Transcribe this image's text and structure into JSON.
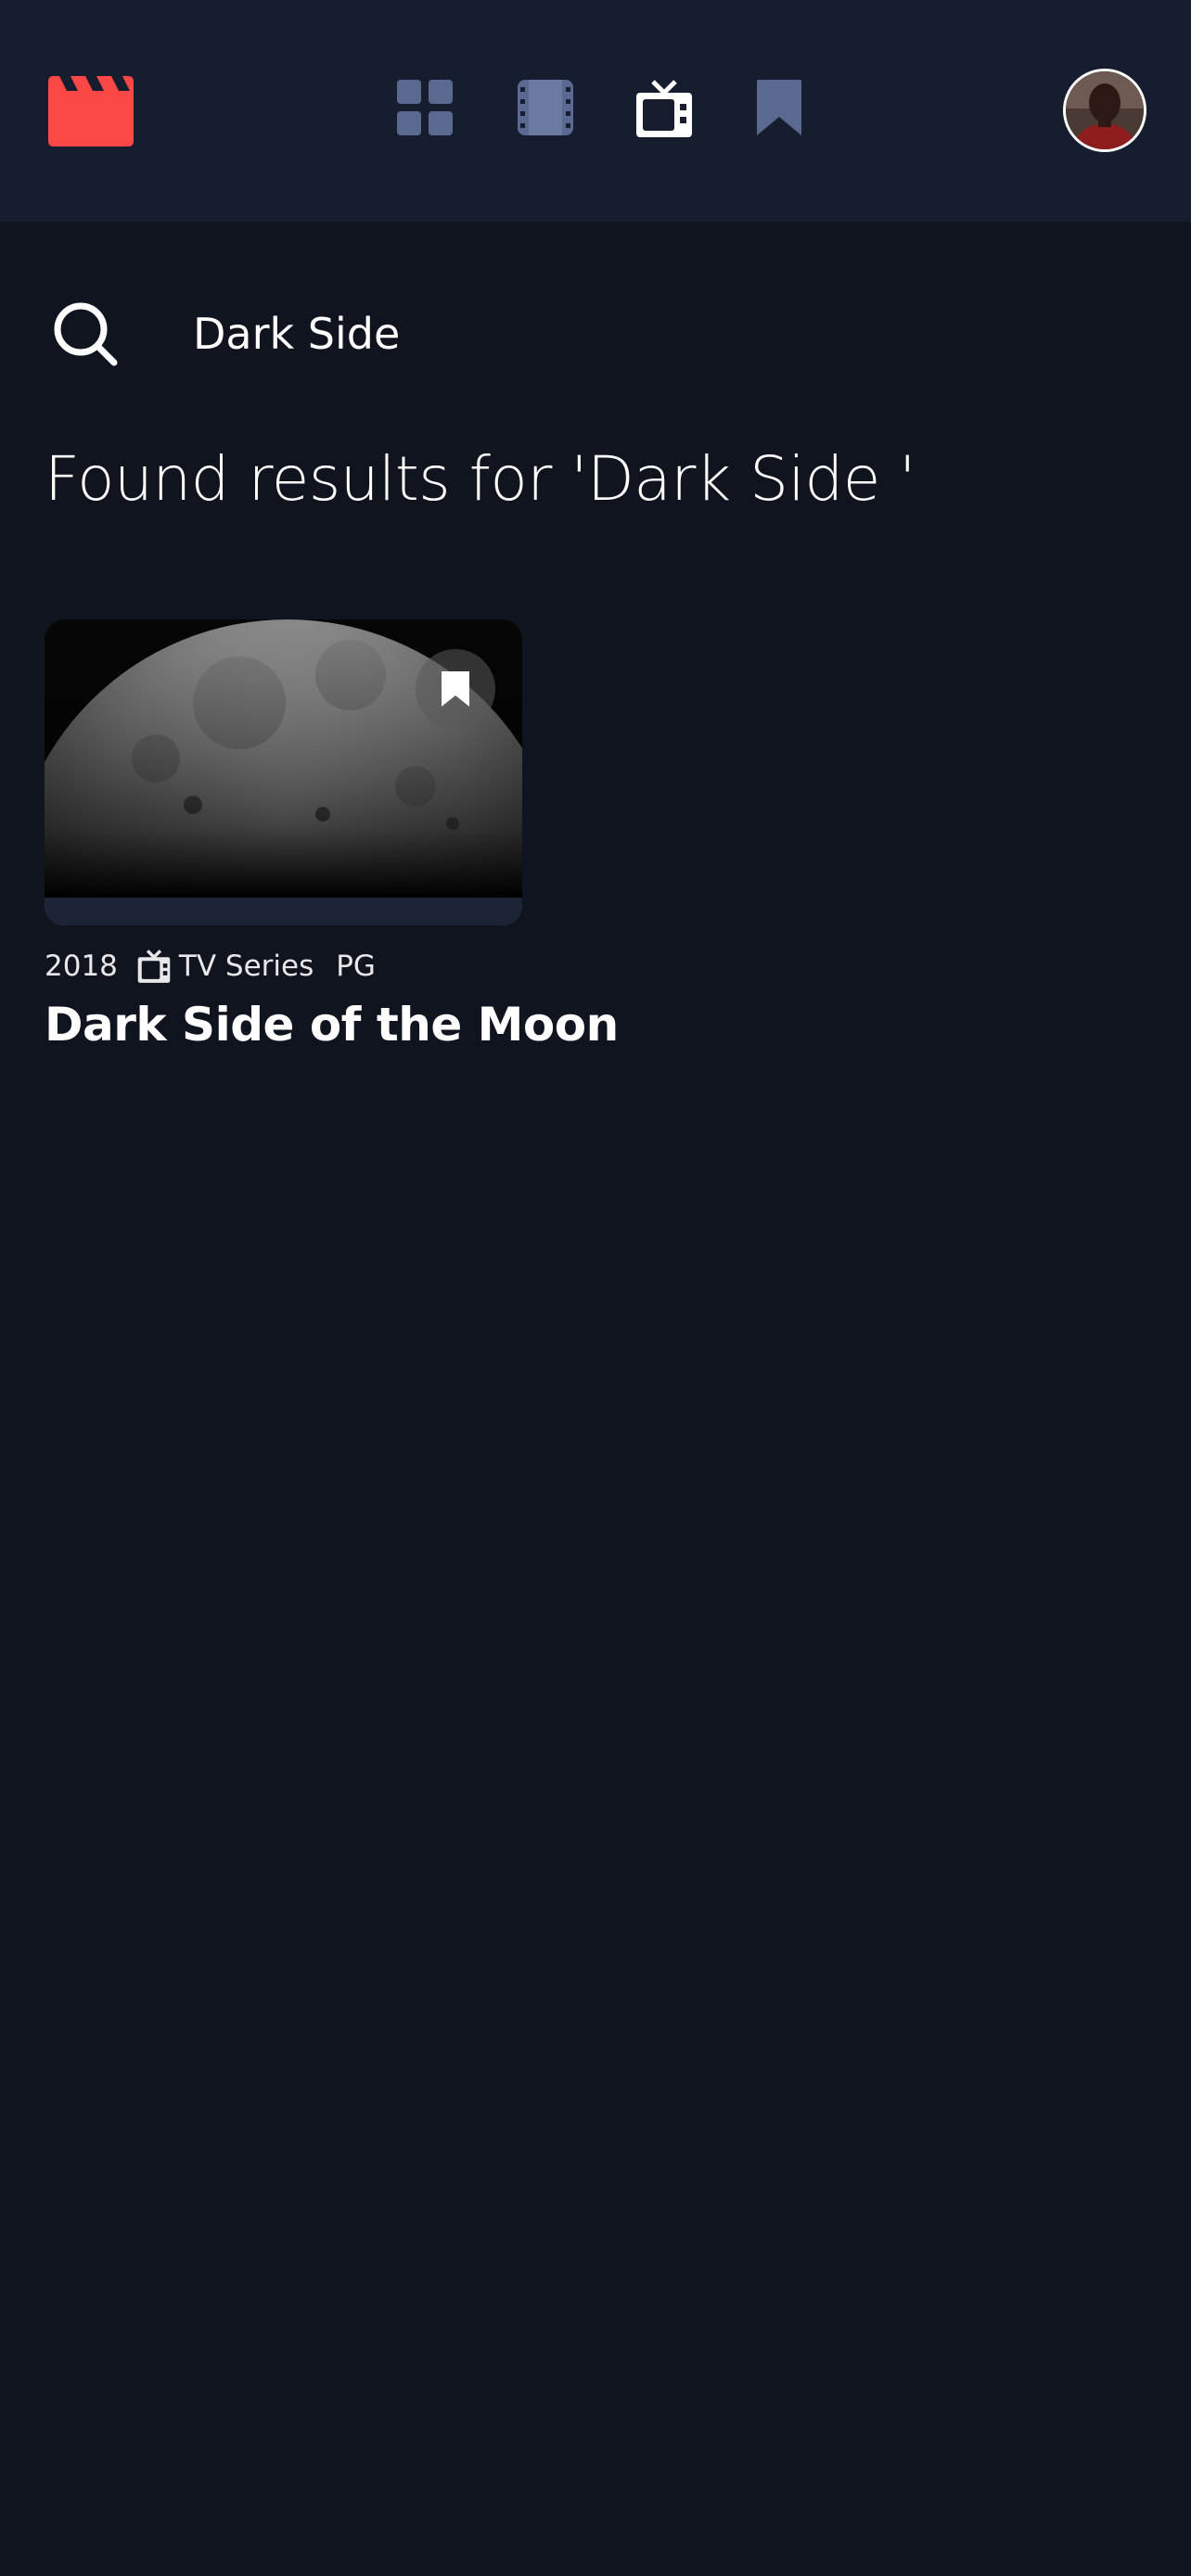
{
  "nav": {
    "logo_icon": "clapperboard-icon",
    "items": [
      {
        "name": "home",
        "icon": "grid-icon",
        "active": false
      },
      {
        "name": "movies",
        "icon": "film-icon",
        "active": false
      },
      {
        "name": "tv-series",
        "icon": "tv-icon",
        "active": true
      },
      {
        "name": "bookmarks",
        "icon": "bookmark-icon",
        "active": false
      }
    ],
    "avatar_icon": "user-avatar"
  },
  "search": {
    "value": "Dark Side",
    "icon": "search-icon"
  },
  "results": {
    "heading": "Found results for 'Dark Side '"
  },
  "items": [
    {
      "year": "2018",
      "category": "TV Series",
      "category_icon": "tv-icon",
      "rating": "PG",
      "title": "Dark Side of the Moon",
      "bookmarked": false
    }
  ],
  "colors": {
    "background": "#10141e",
    "header": "#161d2f",
    "accent_red": "#fc4747",
    "nav_inactive": "#5a698f",
    "text": "#ffffff"
  }
}
